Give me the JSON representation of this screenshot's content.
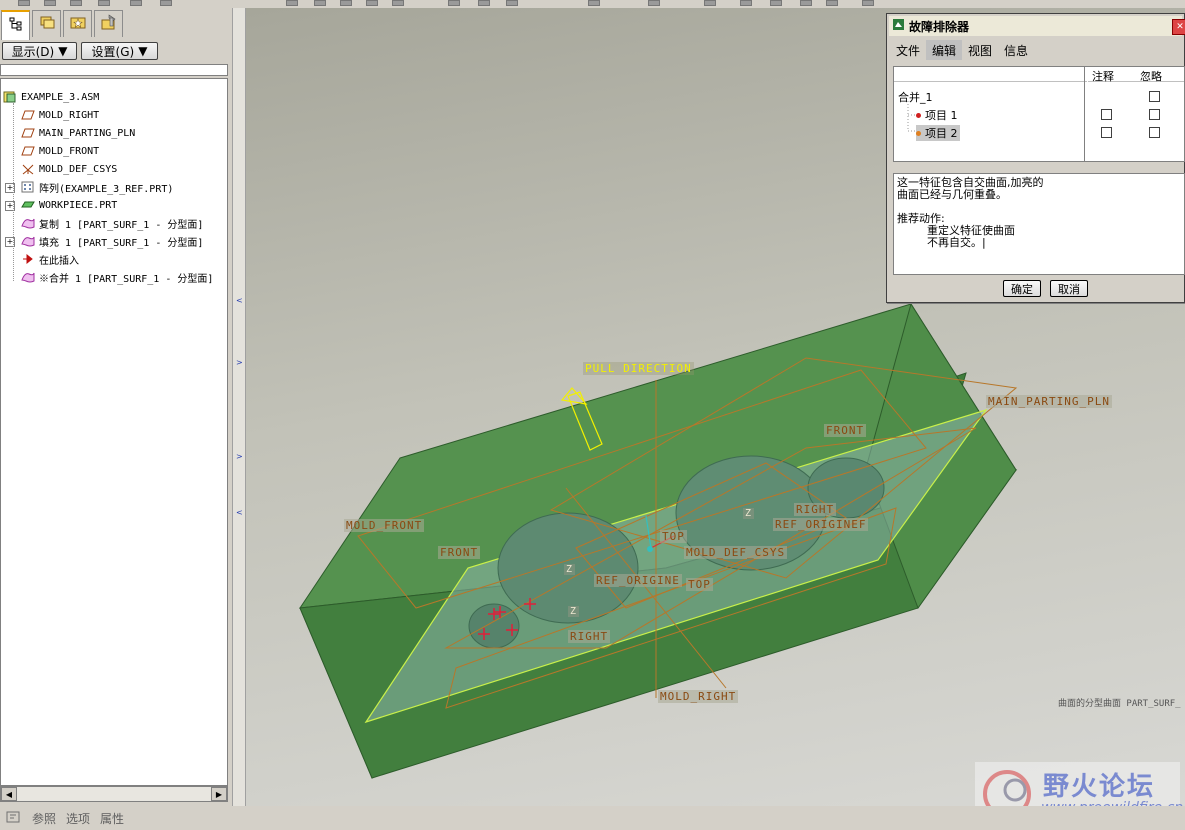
{
  "tree": {
    "tabs": [
      {
        "icon": "model-tree-icon"
      },
      {
        "icon": "folder-browser-icon"
      },
      {
        "icon": "favorites-icon"
      },
      {
        "icon": "connections-icon"
      }
    ],
    "show_menu": "显示(D)",
    "settings_menu": "设置(G)",
    "nodes": [
      {
        "label": "EXAMPLE_3.ASM",
        "mono": true,
        "icon": "assembly-icon",
        "indent": 0
      },
      {
        "label": "MOLD_RIGHT",
        "mono": true,
        "icon": "datum-plane-icon",
        "indent": 1
      },
      {
        "label": "MAIN_PARTING_PLN",
        "mono": true,
        "icon": "datum-plane-icon",
        "indent": 1
      },
      {
        "label": "MOLD_FRONT",
        "mono": true,
        "icon": "datum-plane-icon",
        "indent": 1
      },
      {
        "label": "MOLD_DEF_CSYS",
        "mono": true,
        "icon": "csys-icon",
        "indent": 1
      },
      {
        "label": "阵列(EXAMPLE_3_REF.PRT)",
        "mono": true,
        "icon": "pattern-icon",
        "indent": 1,
        "expander": true
      },
      {
        "label": "WORKPIECE.PRT",
        "mono": true,
        "icon": "part-icon",
        "indent": 1,
        "expander": true
      },
      {
        "label": "复制 1 [PART_SURF_1 - 分型面]",
        "mono": true,
        "icon": "surface-icon",
        "indent": 1
      },
      {
        "label": "填充 1 [PART_SURF_1 - 分型面]",
        "mono": true,
        "icon": "surface-icon",
        "indent": 1,
        "expander": true
      },
      {
        "label": "在此插入",
        "mono": true,
        "icon": "insert-here-icon",
        "indent": 1
      },
      {
        "label": "※合并 1 [PART_SURF_1 - 分型面]",
        "mono": true,
        "icon": "surface-icon",
        "indent": 1
      }
    ]
  },
  "status": {
    "items": [
      "参照",
      "选项",
      "属性"
    ]
  },
  "viewport": {
    "labels": {
      "pull_direction": "PULL DIRECTION",
      "main_parting_pln": "MAIN_PARTING_PLN",
      "front_top": "FRONT",
      "mold_front": "MOLD_FRONT",
      "front_left": "FRONT",
      "right_top": "RIGHT",
      "ref_origin_right": "REF_ORIGINEF",
      "ref_origin_left": "REF_ORIGINE",
      "top_left": "TOP",
      "top_mid": "TOP",
      "mold_def_csys": "MOLD_DEF_CSYS",
      "right_bottom": "RIGHT",
      "mold_right": "MOLD_RIGHT",
      "z1": "Z",
      "z2": "Z",
      "z3": "Z",
      "surf_note": "曲面的分型曲面 PART_SURF_"
    }
  },
  "dialog": {
    "title": "故障排除器",
    "menu": [
      "文件",
      "编辑",
      "视图",
      "信息"
    ],
    "menu_selected": 1,
    "columns": {
      "note": "注释",
      "ignore": "忽略"
    },
    "group": "合并_1",
    "items": [
      {
        "label": "项目 1",
        "bullet_color": "#d02020"
      },
      {
        "label": "项目 2",
        "bullet_color": "#e08020",
        "selected": true
      }
    ],
    "description": [
      "这一特征包含自交曲面,加亮的",
      "曲面已经与几何重叠。",
      "",
      "推荐动作:",
      "重定义特征使曲面",
      "不再自交。|"
    ],
    "ok": "确定",
    "cancel": "取消"
  },
  "watermark": {
    "title": "野火论坛",
    "url": "www.proewildfire.cn"
  }
}
